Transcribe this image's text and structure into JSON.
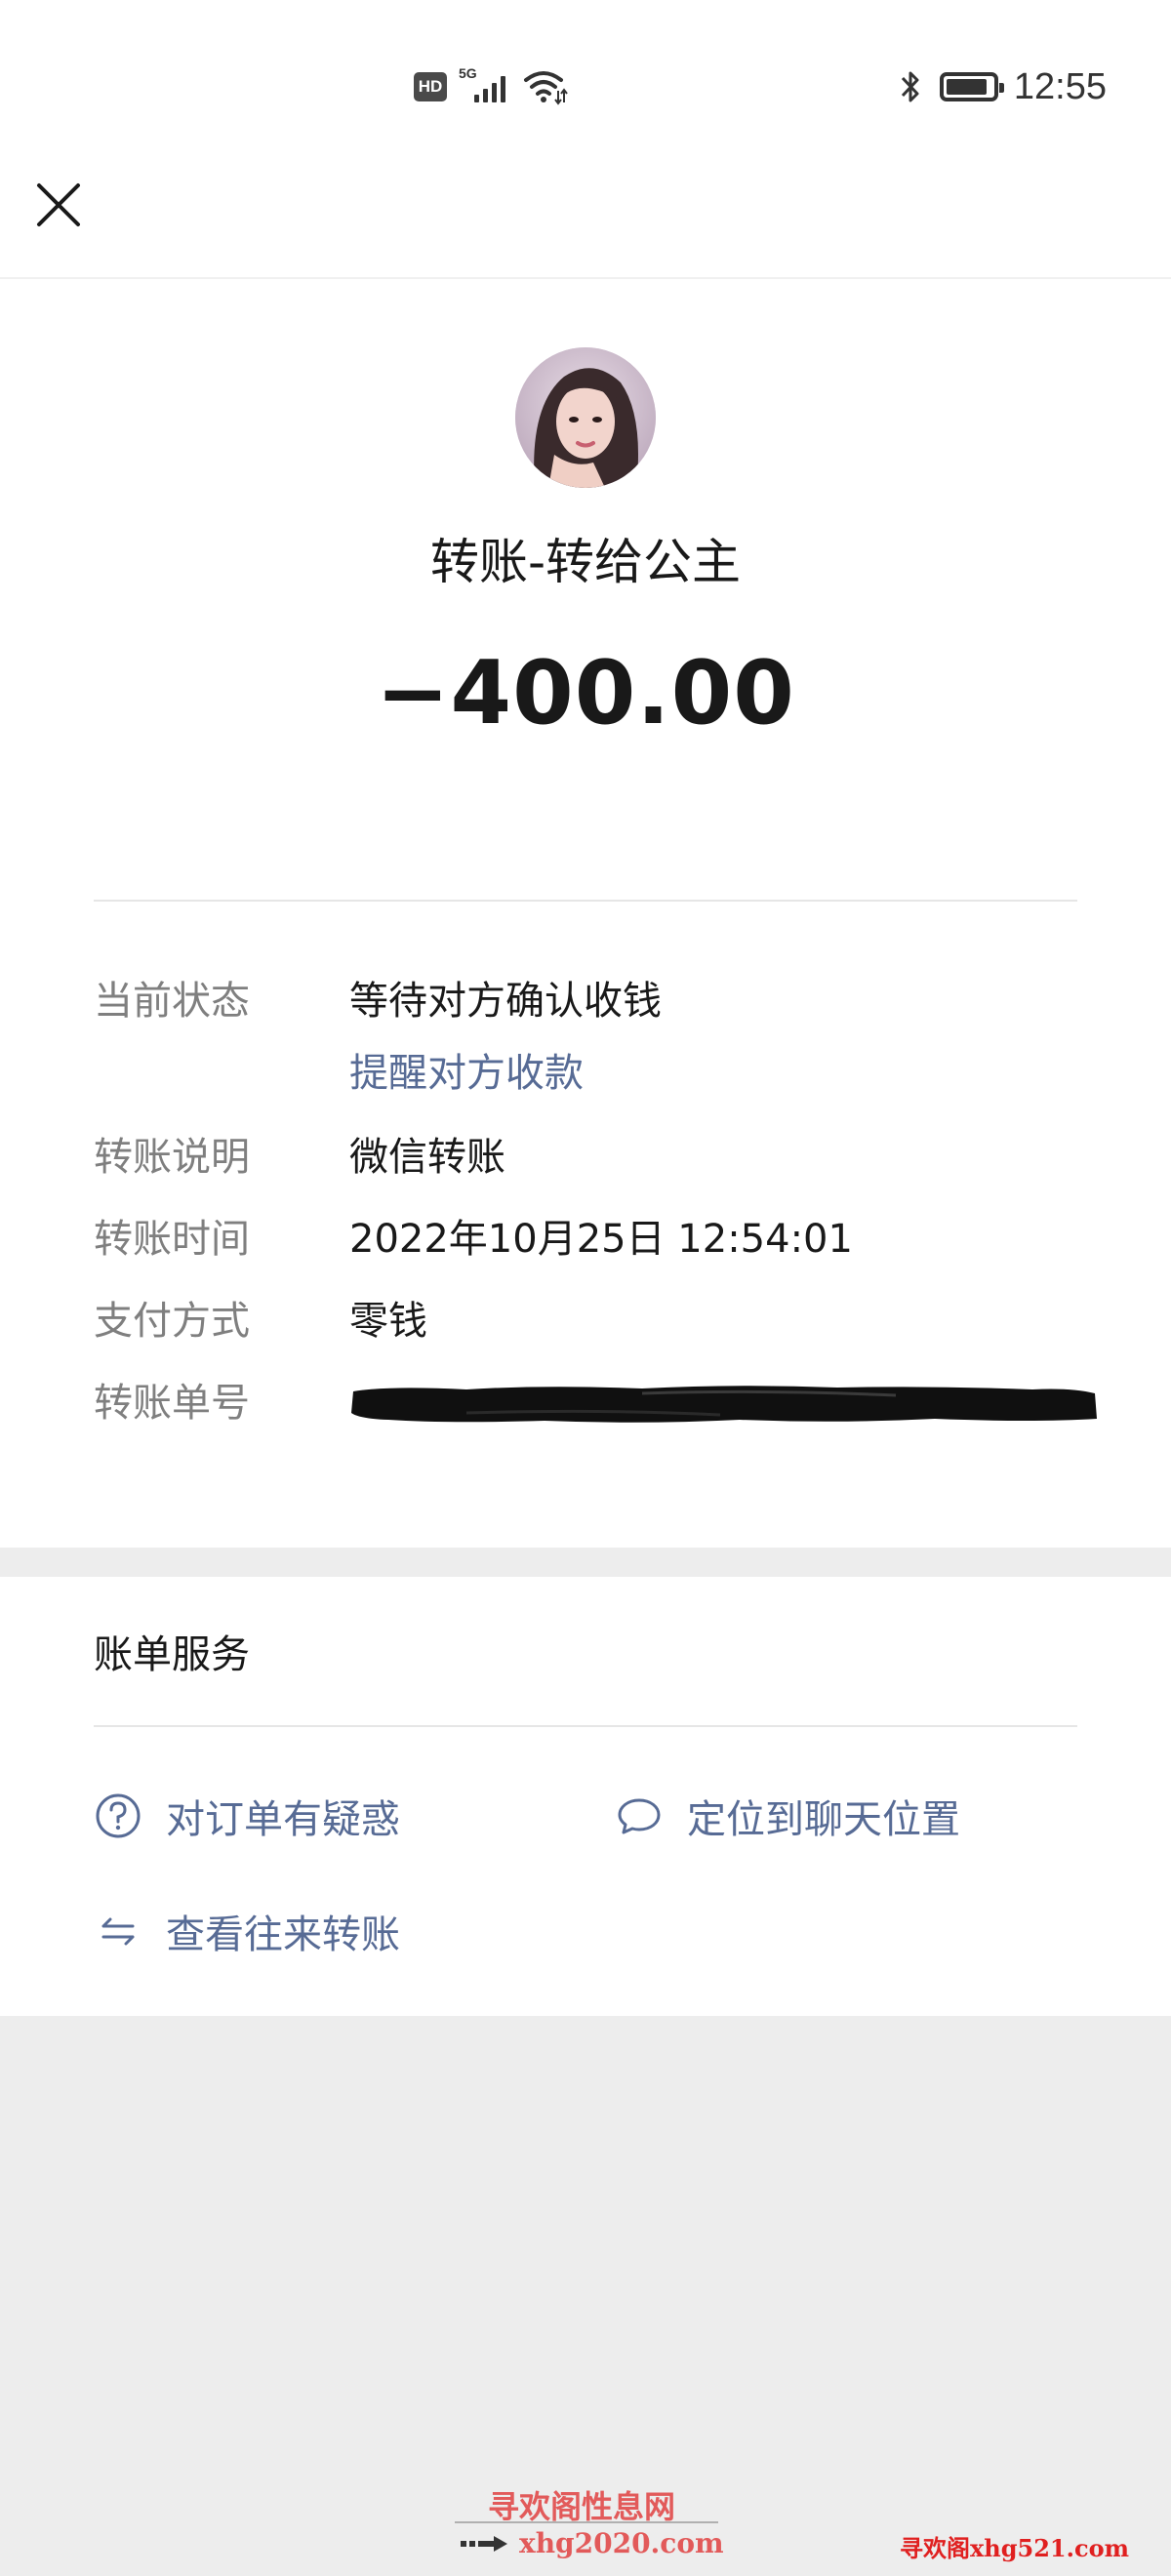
{
  "status_bar": {
    "hd_label": "HD",
    "network_label": "5G",
    "time": "12:55",
    "battery_level": 0.9
  },
  "header": {
    "close_icon": "close-icon"
  },
  "transfer": {
    "title": "转账-转给公主",
    "amount": "−400.00"
  },
  "details": {
    "status_label": "当前状态",
    "status_value": "等待对方确认收钱",
    "remind_link": "提醒对方收款",
    "note_label": "转账说明",
    "note_value": "微信转账",
    "time_label": "转账时间",
    "time_value": "2022年10月25日 12:54:01",
    "method_label": "支付方式",
    "method_value": "零钱",
    "order_label": "转账单号"
  },
  "service": {
    "title": "账单服务",
    "items": [
      {
        "label": "对订单有疑惑",
        "icon": "question-circle-icon"
      },
      {
        "label": "定位到聊天位置",
        "icon": "chat-bubble-icon"
      },
      {
        "label": "查看往来转账",
        "icon": "swap-arrows-icon"
      }
    ]
  },
  "watermarks": {
    "line1": "寻欢阁性息网",
    "line2": "xhg2020.com",
    "line3": "寻欢阁xhg521.com"
  },
  "colors": {
    "link": "#576b95",
    "label_gray": "#7f7f7f",
    "background": "#ededed",
    "card": "#ffffff"
  }
}
